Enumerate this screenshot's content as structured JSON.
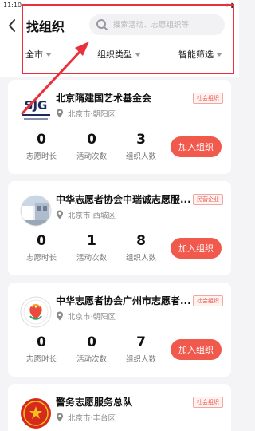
{
  "status_bar": {
    "time": "11:10"
  },
  "header": {
    "title": "找组织",
    "search_placeholder": "搜索活动、志愿组织等",
    "filters": [
      {
        "label": "全市"
      },
      {
        "label": "组织类型"
      },
      {
        "label": "智能筛选"
      }
    ]
  },
  "join_label": "加入组织",
  "stat_labels": [
    "志愿时长",
    "活动次数",
    "组织人数"
  ],
  "colors": {
    "accent": "#f1594c",
    "highlight": "#e8313a",
    "tag_text": "#e8574b"
  },
  "organizations": [
    {
      "name": "北京隋建国艺术基金会",
      "tag": "社会组织",
      "location": "北京市·朝阳区",
      "stats": [
        "0",
        "0",
        "3"
      ],
      "logo_text": "SJG"
    },
    {
      "name": "中华志愿者协会中瑞诚志愿服...",
      "tag": "民营企业",
      "location": "北京市·西城区",
      "stats": [
        "0",
        "1",
        "8"
      ]
    },
    {
      "name": "中华志愿者协会广州市志愿者...",
      "tag": "社会组织",
      "location": "北京市·朝阳区",
      "stats": [
        "0",
        "0",
        "7"
      ]
    },
    {
      "name": "警务志愿服务总队",
      "tag": "社会组织",
      "location": "北京市·丰台区",
      "stats": []
    }
  ]
}
